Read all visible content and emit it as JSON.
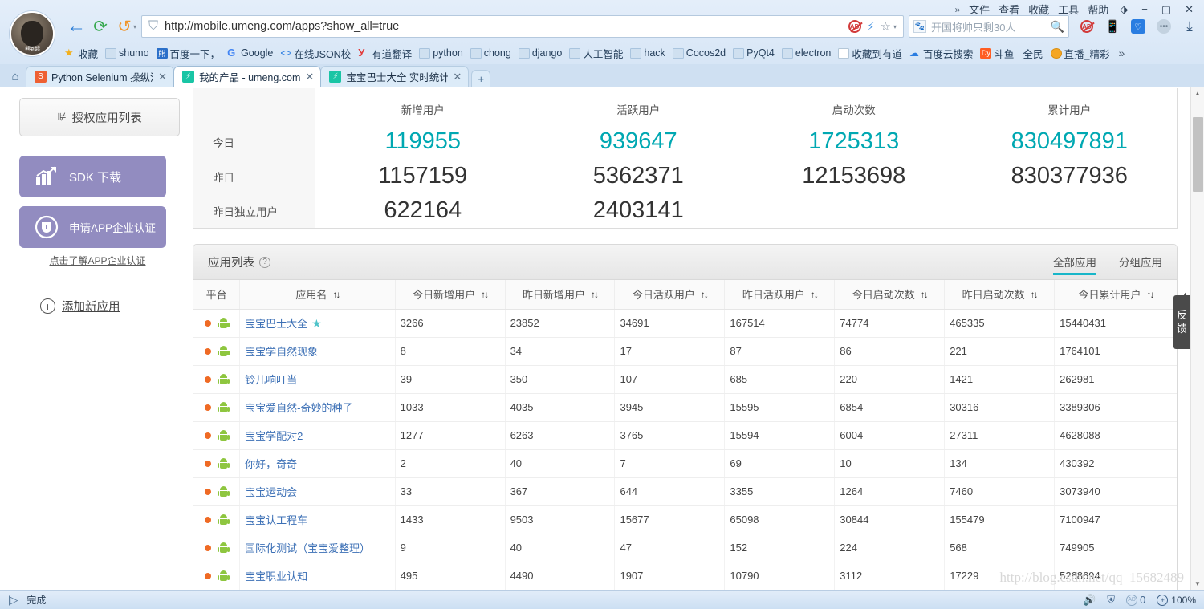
{
  "browser": {
    "menu": [
      "文件",
      "查看",
      "收藏",
      "工具",
      "帮助"
    ],
    "menu_overflow": "»",
    "window_controls": {
      "minimize": "−",
      "maximize": "▢",
      "close": "✕",
      "restore_icon": "restore-icon"
    },
    "nav": {
      "back": "←",
      "reload": "⟳",
      "history": "↺",
      "history_caret": "▾"
    },
    "url": {
      "value": "http://mobile.umeng.com/apps?show_all=true",
      "domain": "mobile.umeng.com",
      "path": "/apps?show_all=true",
      "shield_icon": "shield-icon"
    },
    "url_actions": {
      "adblock": "AD",
      "lightning": "⚡",
      "favorite": "☆",
      "caret": "▾"
    },
    "search": {
      "placeholder": "开国将帅只剩30人",
      "value": "",
      "go_icon": "search-icon"
    },
    "toolbar_icons": [
      "adblock-icon",
      "mobile-preview-icon",
      "security-shield-icon",
      "more-dots-icon",
      "download-icon"
    ],
    "bookmarks": [
      {
        "label": "收藏",
        "icon": "star-icon"
      },
      {
        "label": "shumo",
        "icon": "folder-icon"
      },
      {
        "label": "百度一下，",
        "icon": "baidu-icon"
      },
      {
        "label": "Google",
        "icon": "google-icon"
      },
      {
        "label": "在线JSON校",
        "icon": "json-icon"
      },
      {
        "label": "有道翻译",
        "icon": "youdao-icon"
      },
      {
        "label": "python",
        "icon": "folder-icon"
      },
      {
        "label": "chong",
        "icon": "folder-icon"
      },
      {
        "label": "django",
        "icon": "folder-icon"
      },
      {
        "label": "人工智能",
        "icon": "folder-icon"
      },
      {
        "label": "hack",
        "icon": "folder-icon"
      },
      {
        "label": "Cocos2d",
        "icon": "folder-icon"
      },
      {
        "label": "PyQt4",
        "icon": "folder-icon"
      },
      {
        "label": "electron",
        "icon": "folder-icon"
      },
      {
        "label": "收藏到有道",
        "icon": "note-icon"
      },
      {
        "label": "百度云搜索",
        "icon": "cloud-icon"
      },
      {
        "label": "斗鱼 - 全民",
        "icon": "douyu-icon"
      },
      {
        "label": "直播_精彩",
        "icon": "live-icon"
      }
    ],
    "bookmarks_more": "»",
    "home_icon": "home-icon",
    "tabs": [
      {
        "label": "Python Selenium 操纵沒",
        "favicon": "selenium-icon",
        "active": false
      },
      {
        "label": "我的产品 - umeng.com",
        "favicon": "umeng-icon",
        "active": true
      },
      {
        "label": "宝宝巴士大全 实时统计",
        "favicon": "umeng-icon",
        "active": false
      }
    ],
    "new_tab": "+",
    "tab_close": "✕"
  },
  "sidebar": {
    "auth_list": {
      "label": "授权应用列表",
      "icon": "chart-list-icon"
    },
    "sdk_button": {
      "label": "SDK 下载",
      "icon": "chart-up-icon"
    },
    "cert_button": {
      "label": "申请APP企业认证",
      "icon": "shield-badge-icon"
    },
    "cert_link": "点击了解APP企业认证",
    "add_app": {
      "label": "添加新应用",
      "icon": "plus-circle-icon"
    }
  },
  "summary": {
    "row_labels": [
      "今日",
      "昨日",
      "昨日独立用户"
    ],
    "columns": [
      {
        "header": "新增用户",
        "values": [
          "119955",
          "1157159",
          "622164"
        ]
      },
      {
        "header": "活跃用户",
        "values": [
          "939647",
          "5362371",
          "2403141"
        ]
      },
      {
        "header": "启动次数",
        "values": [
          "1725313",
          "12153698",
          ""
        ]
      },
      {
        "header": "累计用户",
        "values": [
          "830497891",
          "830377936",
          ""
        ]
      }
    ]
  },
  "applist": {
    "title": "应用列表",
    "help_icon": "question-mark-icon",
    "tabs": [
      {
        "label": "全部应用",
        "active": true
      },
      {
        "label": "分组应用",
        "active": false
      }
    ],
    "columns": [
      {
        "label": "平台",
        "sortable": false
      },
      {
        "label": "应用名",
        "sortable": true
      },
      {
        "label": "今日新增用户",
        "sortable": true
      },
      {
        "label": "昨日新增用户",
        "sortable": true
      },
      {
        "label": "今日活跃用户",
        "sortable": true
      },
      {
        "label": "昨日活跃用户",
        "sortable": true
      },
      {
        "label": "今日启动次数",
        "sortable": true
      },
      {
        "label": "昨日启动次数",
        "sortable": true
      },
      {
        "label": "今日累计用户",
        "sortable": true
      }
    ],
    "sort_icon": "sort-updown-icon",
    "platform_icons": [
      "status-dot-icon",
      "android-icon"
    ],
    "star_icon": "star-badge-icon",
    "rows": [
      {
        "name": "宝宝巴士大全",
        "starred": true,
        "today_new": "3266",
        "yest_new": "23852",
        "today_active": "34691",
        "yest_active": "167514",
        "today_launch": "74774",
        "yest_launch": "465335",
        "today_total": "15440431"
      },
      {
        "name": "宝宝学自然现象",
        "starred": false,
        "today_new": "8",
        "yest_new": "34",
        "today_active": "17",
        "yest_active": "87",
        "today_launch": "86",
        "yest_launch": "221",
        "today_total": "1764101"
      },
      {
        "name": "铃儿响叮当",
        "starred": false,
        "today_new": "39",
        "yest_new": "350",
        "today_active": "107",
        "yest_active": "685",
        "today_launch": "220",
        "yest_launch": "1421",
        "today_total": "262981"
      },
      {
        "name": "宝宝爱自然-奇妙的种子",
        "starred": false,
        "today_new": "1033",
        "yest_new": "4035",
        "today_active": "3945",
        "yest_active": "15595",
        "today_launch": "6854",
        "yest_launch": "30316",
        "today_total": "3389306"
      },
      {
        "name": "宝宝学配对2",
        "starred": false,
        "today_new": "1277",
        "yest_new": "6263",
        "today_active": "3765",
        "yest_active": "15594",
        "today_launch": "6004",
        "yest_launch": "27311",
        "today_total": "4628088"
      },
      {
        "name": "你好，奇奇",
        "starred": false,
        "today_new": "2",
        "yest_new": "40",
        "today_active": "7",
        "yest_active": "69",
        "today_launch": "10",
        "yest_launch": "134",
        "today_total": "430392"
      },
      {
        "name": "宝宝运动会",
        "starred": false,
        "today_new": "33",
        "yest_new": "367",
        "today_active": "644",
        "yest_active": "3355",
        "today_launch": "1264",
        "yest_launch": "7460",
        "today_total": "3073940"
      },
      {
        "name": "宝宝认工程车",
        "starred": false,
        "today_new": "1433",
        "yest_new": "9503",
        "today_active": "15677",
        "yest_active": "65098",
        "today_launch": "30844",
        "yest_launch": "155479",
        "today_total": "7100947"
      },
      {
        "name": "国际化测试（宝宝爱整理）",
        "starred": false,
        "today_new": "9",
        "yest_new": "40",
        "today_active": "47",
        "yest_active": "152",
        "today_launch": "224",
        "yest_launch": "568",
        "today_total": "749905"
      },
      {
        "name": "宝宝职业认知",
        "starred": false,
        "today_new": "495",
        "yest_new": "4490",
        "today_active": "1907",
        "yest_active": "10790",
        "today_launch": "3112",
        "yest_launch": "17229",
        "today_total": "5268694"
      }
    ]
  },
  "feedback": {
    "label": "反馈",
    "line1": "反",
    "line2": "馈"
  },
  "watermark": "http://blog.csdn.net/qq_15682489",
  "statusbar": {
    "text": "完成",
    "ip_icon": "ip-icon",
    "icons": [
      "sound-icon",
      "medkit-icon",
      "adblock-count-icon"
    ],
    "ad_count": "0",
    "zoom": "100%"
  },
  "colors": {
    "teal_accent": "#00a8b2",
    "purple_button": "#928cc0",
    "link_blue": "#3b6fb5",
    "tab_underline": "#18b6c9",
    "android_green": "#8ec63f",
    "status_dot": "#ef6a24"
  }
}
